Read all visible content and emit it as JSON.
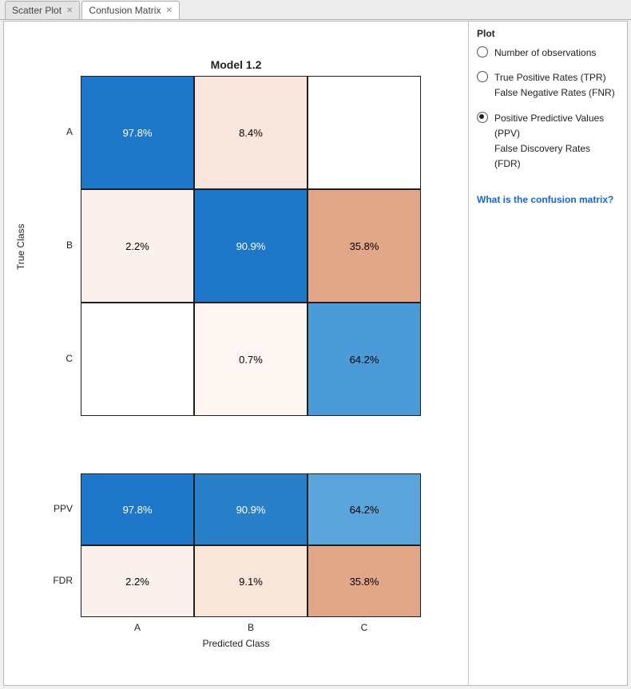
{
  "tabs": [
    {
      "label": "Scatter Plot",
      "active": false
    },
    {
      "label": "Confusion Matrix",
      "active": true
    }
  ],
  "plot": {
    "title": "Model 1.2",
    "ylabel": "True Class",
    "xlabel": "Predicted Class"
  },
  "chart_data": {
    "type": "heatmap",
    "title": "Model 1.2",
    "row_labels": [
      "A",
      "B",
      "C"
    ],
    "col_labels": [
      "A",
      "B",
      "C"
    ],
    "xlabel": "Predicted Class",
    "ylabel": "True Class",
    "matrix_text": [
      [
        "97.8%",
        "8.4%",
        ""
      ],
      [
        "2.2%",
        "90.9%",
        "35.8%"
      ],
      [
        "",
        "0.7%",
        "64.2%"
      ]
    ],
    "matrix_values": [
      [
        97.8,
        8.4,
        null
      ],
      [
        2.2,
        90.9,
        35.8
      ],
      [
        null,
        0.7,
        64.2
      ]
    ],
    "matrix_colors": [
      [
        "#1f77c9",
        "#f9e7dd",
        "#ffffff"
      ],
      [
        "#fbf1ec",
        "#1f77c9",
        "#e2a689"
      ],
      [
        "#ffffff",
        "#fdf6f3",
        "#4a9bd8"
      ]
    ],
    "matrix_txtcolor": [
      [
        "#fff",
        "#000",
        "#000"
      ],
      [
        "#000",
        "#fff",
        "#000"
      ],
      [
        "#000",
        "#000",
        "#000"
      ]
    ],
    "summary_row_labels": [
      "PPV",
      "FDR"
    ],
    "summary_text": [
      [
        "97.8%",
        "90.9%",
        "64.2%"
      ],
      [
        "2.2%",
        "9.1%",
        "35.8%"
      ]
    ],
    "summary_values": [
      [
        97.8,
        90.9,
        64.2
      ],
      [
        2.2,
        9.1,
        35.8
      ]
    ],
    "summary_colors": [
      [
        "#1f77c9",
        "#2a7fc9",
        "#5aa5db"
      ],
      [
        "#fbf1ec",
        "#f9e6db",
        "#e2a689"
      ]
    ],
    "summary_txtcolor": [
      [
        "#fff",
        "#fff",
        "#000"
      ],
      [
        "#000",
        "#000",
        "#000"
      ]
    ]
  },
  "side": {
    "heading": "Plot",
    "options": [
      {
        "lines": [
          "Number of observations"
        ],
        "selected": false
      },
      {
        "lines": [
          "True Positive Rates (TPR)",
          "False Negative Rates (FNR)"
        ],
        "selected": false
      },
      {
        "lines": [
          "Positive Predictive Values (PPV)",
          "False Discovery Rates (FDR)"
        ],
        "selected": true
      }
    ],
    "help_link": "What is the confusion matrix?"
  }
}
